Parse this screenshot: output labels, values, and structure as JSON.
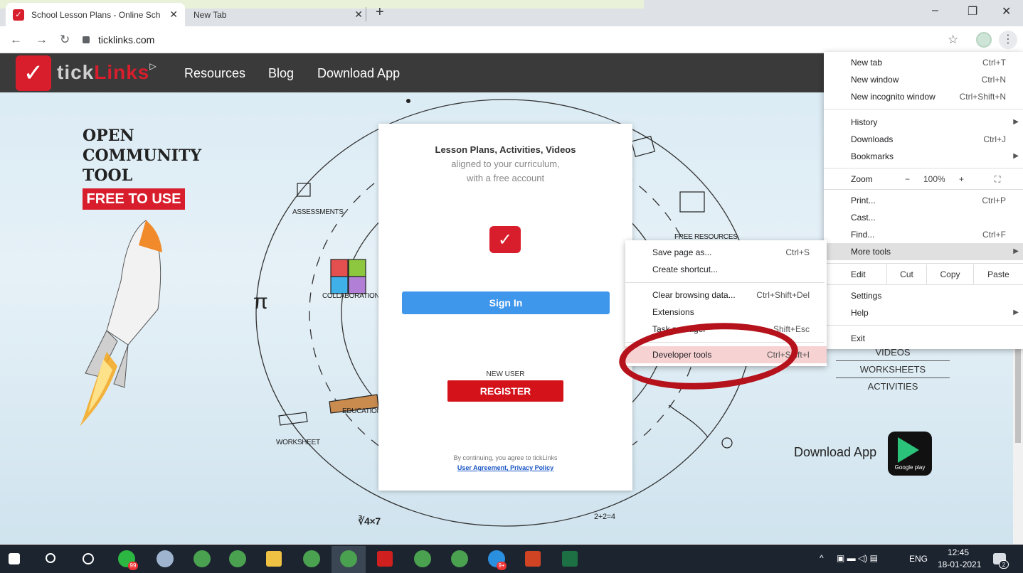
{
  "browser": {
    "tabs": [
      {
        "title": "School Lesson Plans - Online Sch",
        "close": "✕"
      },
      {
        "title": "New Tab",
        "close": "✕"
      }
    ],
    "new_tab": "+",
    "window_controls": {
      "minimize": "–",
      "restore": "❐",
      "close": "✕"
    },
    "nav": {
      "back": "←",
      "forward": "→",
      "reload": "↻"
    },
    "url": "ticklinks.com",
    "bookmark_star": "☆",
    "menu_button": "⋮"
  },
  "site": {
    "logo_text_a": "tick",
    "logo_text_b": "Links",
    "logo_mark": "▷",
    "nav": [
      "Resources",
      "Blog",
      "Download App"
    ],
    "hero": {
      "line1": "OPEN",
      "line2": "COMMUNITY",
      "line3": "TOOL",
      "badge": "FREE TO USE"
    },
    "doodles": {
      "assessments": "ASSESSMENTS",
      "collaboration": "COLLABORATION",
      "free_resources": "FREE RESOURCES",
      "education": "EDUCATION",
      "worksheet": "WORKSHEET",
      "pi": "π",
      "root": "∛4×7",
      "equation": "2+2=4"
    },
    "card": {
      "headline": "Lesson Plans, Activities, Videos",
      "sub1": "aligned to your curriculum,",
      "sub2": "with a free account",
      "signin": "Sign In",
      "new_user": "NEW USER",
      "register": "REGISTER",
      "terms": "By continuing, you agree to tickLinks",
      "links": "User Agreement, Privacy Policy"
    },
    "resources_list": [
      "VIDEOS",
      "WORKSHEETS",
      "ACTIVITIES"
    ],
    "download_app": "Download App",
    "google_play": "Google play"
  },
  "chrome_menu": {
    "items": [
      {
        "label": "New tab",
        "shortcut": "Ctrl+T"
      },
      {
        "label": "New window",
        "shortcut": "Ctrl+N"
      },
      {
        "label": "New incognito window",
        "shortcut": "Ctrl+Shift+N"
      },
      {
        "label": "History",
        "shortcut": ""
      },
      {
        "label": "Downloads",
        "shortcut": "Ctrl+J"
      },
      {
        "label": "Bookmarks",
        "shortcut": ""
      },
      {
        "label": "Print...",
        "shortcut": "Ctrl+P"
      },
      {
        "label": "Cast...",
        "shortcut": ""
      },
      {
        "label": "Find...",
        "shortcut": "Ctrl+F"
      },
      {
        "label": "More tools",
        "shortcut": ""
      },
      {
        "label": "Settings",
        "shortcut": ""
      },
      {
        "label": "Help",
        "shortcut": ""
      },
      {
        "label": "Exit",
        "shortcut": ""
      }
    ],
    "zoom": {
      "label": "Zoom",
      "minus": "−",
      "value": "100%",
      "plus": "+",
      "fullscreen": "⛶"
    },
    "edit": {
      "label": "Edit",
      "cut": "Cut",
      "copy": "Copy",
      "paste": "Paste"
    }
  },
  "more_tools_menu": {
    "items": [
      {
        "label": "Save page as...",
        "shortcut": "Ctrl+S"
      },
      {
        "label": "Create shortcut...",
        "shortcut": ""
      },
      {
        "label": "Clear browsing data...",
        "shortcut": "Ctrl+Shift+Del"
      },
      {
        "label": "Extensions",
        "shortcut": ""
      },
      {
        "label": "Task manager",
        "shortcut": "Shift+Esc"
      },
      {
        "label": "Developer tools",
        "shortcut": "Ctrl+Shift+I"
      }
    ]
  },
  "taskbar": {
    "language": "ENG",
    "time": "12:45",
    "date": "18-01-2021",
    "badges": {
      "whatsapp": "99",
      "skype": "9+",
      "notifications": "2"
    }
  }
}
